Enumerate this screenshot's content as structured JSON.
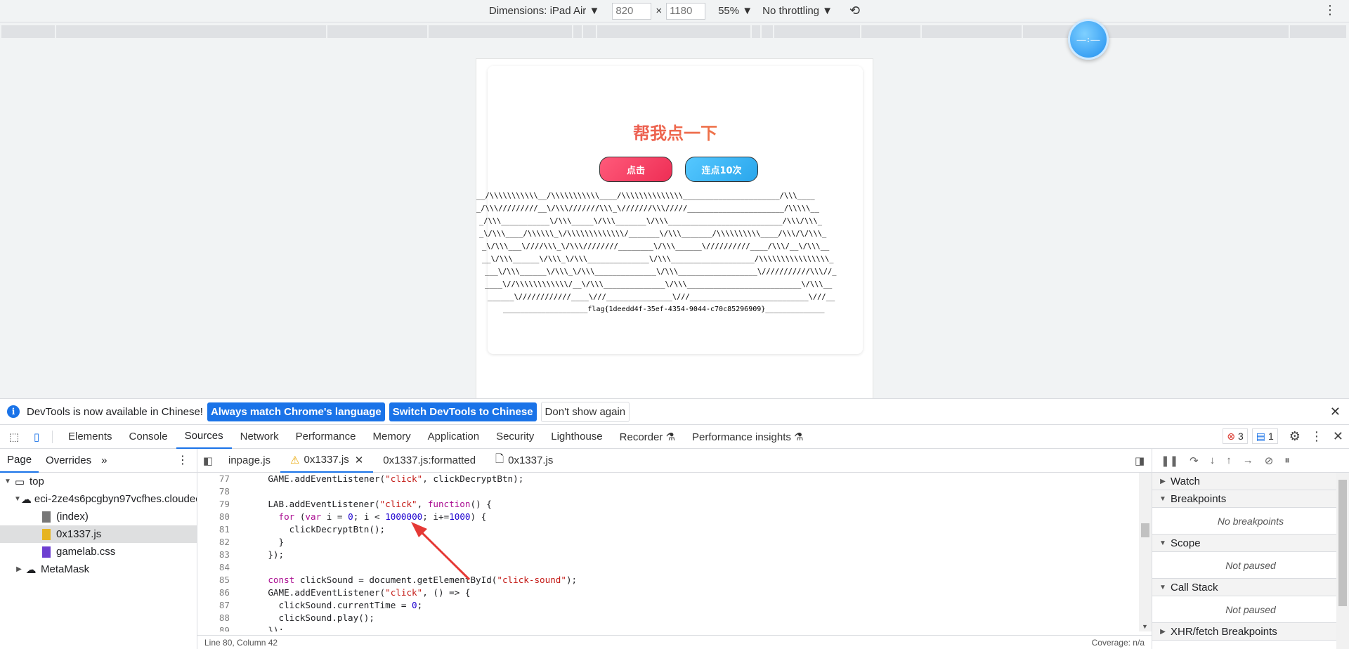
{
  "device_toolbar": {
    "dimensions": "Dimensions: iPad Air",
    "width": "820",
    "height": "1180",
    "times": "×",
    "zoom": "55%",
    "throttling": "No throttling"
  },
  "float_circle": "——:——",
  "page": {
    "title": "帮我点一下",
    "btn_click": "点击",
    "btn_ten": "连点10次",
    "ascii_lines": [
      "__/\\\\\\\\\\\\\\\\\\\\\\__/\\\\\\\\\\\\\\\\\\\\\\____/\\\\\\\\\\\\\\\\\\\\\\\\\\\\______________________/\\\\\\____",
      "_/\\\\\\/////////__\\/\\\\\\///////\\\\\\_\\///////\\\\\\/////______________________/\\\\\\\\\\__",
      "_/\\\\\\___________\\/\\\\\\_____\\/\\\\\\_______\\/\\\\\\__________________________/\\\\\\/\\\\\\_",
      "_\\/\\\\\\____/\\\\\\\\\\\\_\\/\\\\\\\\\\\\\\\\\\\\\\\\\\/_______\\/\\\\\\_______/\\\\\\\\\\\\\\\\\\\\____/\\\\\\/\\/\\\\\\_",
      "_\\/\\\\\\___\\////\\\\\\_\\/\\\\\\////////________\\/\\\\\\______\\//////////____/\\\\\\/__\\/\\\\\\__",
      "__\\/\\\\\\______\\/\\\\\\_\\/\\\\\\______________\\/\\\\\\___________________/\\\\\\\\\\\\\\\\\\\\\\\\\\\\\\\\_",
      "___\\/\\\\\\______\\/\\\\\\_\\/\\\\\\______________\\/\\\\\\__________________\\///////////\\\\\\//_",
      "____\\//\\\\\\\\\\\\\\\\\\\\\\\\/__\\/\\\\\\______________\\/\\\\\\__________________________\\/\\\\\\__",
      "______\\////////////____\\///_______________\\///___________________________\\///__"
    ],
    "flag_line": "____________________flag{1deedd4f-35ef-4354-9044-c70c85296909}______________"
  },
  "infobar": {
    "message": "DevTools is now available in Chinese!",
    "btn_match": "Always match Chrome's language",
    "btn_switch": "Switch DevTools to Chinese",
    "btn_dont": "Don't show again"
  },
  "devtools_tabs": [
    "Elements",
    "Console",
    "Sources",
    "Network",
    "Performance",
    "Memory",
    "Application",
    "Security",
    "Lighthouse",
    "Recorder ⚗",
    "Performance insights ⚗"
  ],
  "badges": {
    "errors": "3",
    "messages": "1"
  },
  "navigator": {
    "tabs": [
      "Page",
      "Overrides"
    ],
    "more": "»",
    "tree": [
      {
        "label": "top",
        "indent": 0,
        "type": "frame",
        "open": true
      },
      {
        "label": "eci-2ze4s6pcgbyn97vcfhes.cloudeci1.ichunqiu.com",
        "indent": 1,
        "type": "cloud",
        "open": true
      },
      {
        "label": "(index)",
        "indent": 2,
        "type": "doc"
      },
      {
        "label": "0x1337.js",
        "indent": 2,
        "type": "js",
        "selected": true
      },
      {
        "label": "gamelab.css",
        "indent": 2,
        "type": "css"
      },
      {
        "label": "MetaMask",
        "indent": 1,
        "type": "cloud",
        "open": false
      }
    ]
  },
  "editor": {
    "tabs": [
      {
        "label": "inpage.js"
      },
      {
        "label": "0x1337.js",
        "active": true,
        "warn": true,
        "closable": true
      },
      {
        "label": "0x1337.js:formatted"
      },
      {
        "label": "0x1337.js",
        "file": true
      }
    ],
    "lines": [
      {
        "n": "77",
        "html": "    GAME.addEventListener(<span class=\"str\">\"click\"</span>, clickDecryptBtn);"
      },
      {
        "n": "78",
        "html": ""
      },
      {
        "n": "79",
        "html": "    LAB.addEventListener(<span class=\"str\">\"click\"</span>, <span class=\"kw\">function</span>() {"
      },
      {
        "n": "80",
        "html": "      <span class=\"kw\">for</span> (<span class=\"kw\">var</span> i = <span class=\"num\">0</span>; i &lt; <span class=\"num\">1000000</span>; i+=<span class=\"num\">1000</span>) {"
      },
      {
        "n": "81",
        "html": "        clickDecryptBtn();"
      },
      {
        "n": "82",
        "html": "      }"
      },
      {
        "n": "83",
        "html": "    });"
      },
      {
        "n": "84",
        "html": ""
      },
      {
        "n": "85",
        "html": "    <span class=\"kw\">const</span> clickSound = document.getElementById(<span class=\"str\">\"click-sound\"</span>);"
      },
      {
        "n": "86",
        "html": "    GAME.addEventListener(<span class=\"str\">\"click\"</span>, () => {"
      },
      {
        "n": "87",
        "html": "      clickSound.currentTime = <span class=\"num\">0</span>;"
      },
      {
        "n": "88",
        "html": "      clickSound.play();"
      },
      {
        "n": "89",
        "html": "    });"
      }
    ],
    "status": "Line 80, Column 42",
    "coverage": "Coverage: n/a"
  },
  "debugger": {
    "panes": [
      {
        "title": "Watch"
      },
      {
        "title": "Breakpoints",
        "body": "No breakpoints"
      },
      {
        "title": "Scope",
        "body": "Not paused"
      },
      {
        "title": "Call Stack",
        "body": "Not paused"
      },
      {
        "title": "XHR/fetch Breakpoints"
      }
    ]
  },
  "colors": {
    "accent": "#1a73e8",
    "title_start": "#e8365e",
    "title_end": "#f39a3c",
    "arrow": "#e53935"
  }
}
